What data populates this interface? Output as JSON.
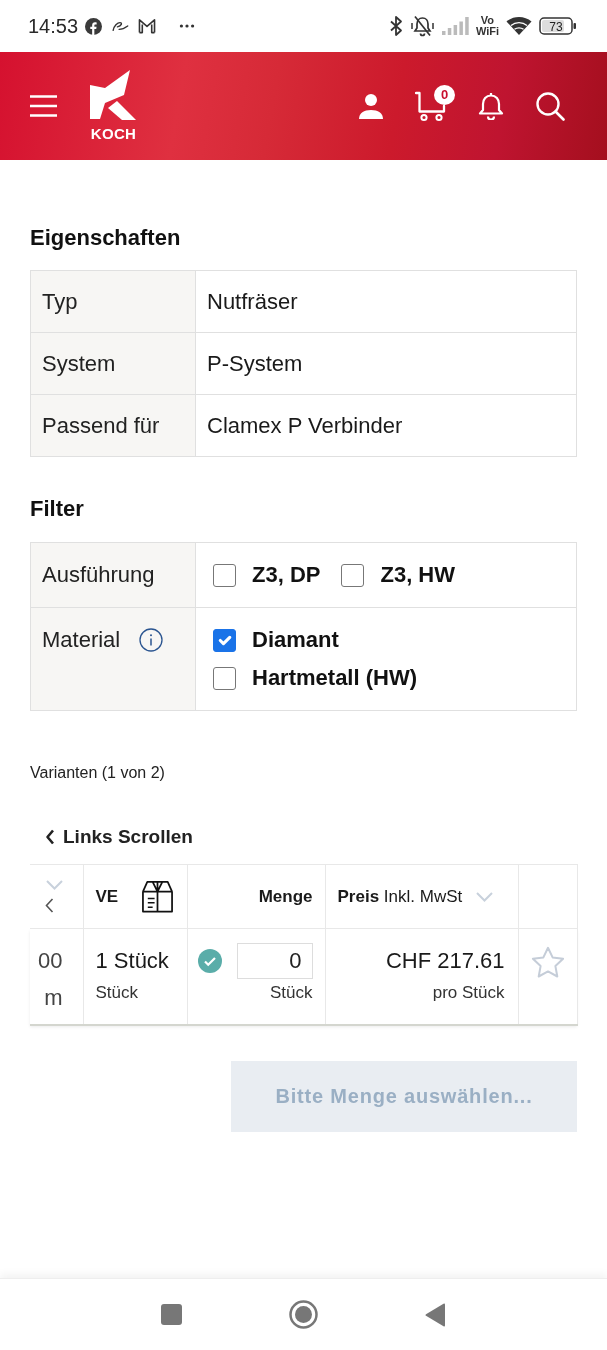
{
  "status_bar": {
    "time": "14:53",
    "network_label": [
      "Vo",
      "WiFi"
    ],
    "battery": "73"
  },
  "header": {
    "logo_text": "KOCH",
    "cart_count": "0"
  },
  "properties": {
    "title": "Eigenschaften",
    "rows": [
      {
        "label": "Typ",
        "value": "Nutfräser"
      },
      {
        "label": "System",
        "value": "P-System"
      },
      {
        "label": "Passend für",
        "value": "Clamex P Verbinder"
      }
    ]
  },
  "filter": {
    "title": "Filter",
    "rows": [
      {
        "label": "Ausführung",
        "info": false,
        "kind": "inline",
        "options": [
          {
            "label": "Z3, DP",
            "checked": false
          },
          {
            "label": "Z3, HW",
            "checked": false
          }
        ]
      },
      {
        "label": "Material",
        "info": true,
        "kind": "stacked",
        "options": [
          {
            "label": "Diamant",
            "checked": true
          },
          {
            "label": "Hartmetall (HW)",
            "checked": false
          }
        ]
      }
    ]
  },
  "variants": {
    "summary": "Varianten (1 von 2)",
    "scroll_left": "Links Scrollen",
    "columns": [
      {
        "kind": "cut"
      },
      {
        "kind": "unit",
        "label": "VE"
      },
      {
        "kind": "quantity",
        "label": "Menge"
      },
      {
        "kind": "price",
        "label": "**Preis** Inkl. MwSt"
      },
      {
        "kind": "favorite"
      }
    ],
    "rows": [
      {
        "column_1": [
          "00",
          "m"
        ],
        "unit": "1 Stück",
        "unit_note": "Stück",
        "available": true,
        "quantity": "0",
        "quantity_unit": "Stück",
        "price": "CHF 217.61",
        "price_note": "pro Stück",
        "favorite": false
      }
    ]
  },
  "order_button": {
    "label": "Bitte Menge auswählen...",
    "disabled": true
  }
}
